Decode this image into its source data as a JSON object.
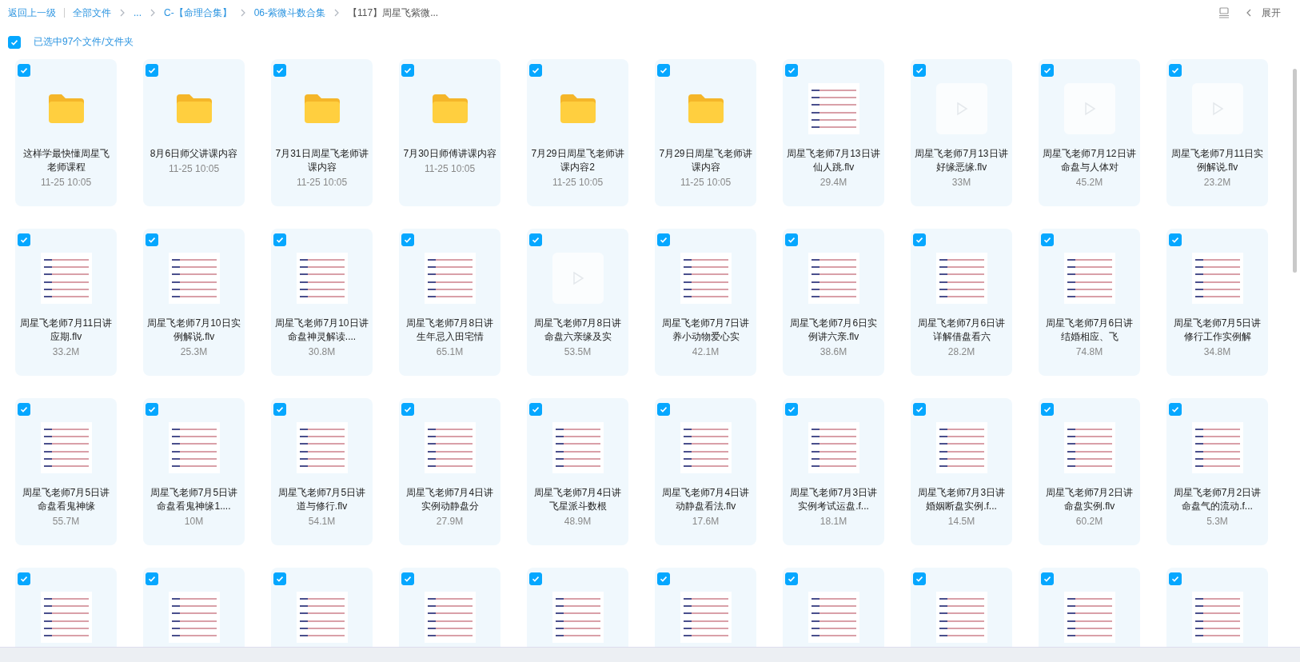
{
  "breadcrumb": {
    "back": "返回上一级",
    "items": [
      {
        "label": "全部文件",
        "current": false
      },
      {
        "label": "...",
        "current": false
      },
      {
        "label": "C-【命理合集】",
        "current": false
      },
      {
        "label": "06-紫微斗数合集",
        "current": false
      },
      {
        "label": "【117】周星飞紫微...",
        "current": true
      }
    ]
  },
  "toolbar": {
    "expand": "展开"
  },
  "selection": {
    "checked": true,
    "label": "已选中97个文件/文件夹"
  },
  "files": [
    {
      "kind": "folder",
      "checked": true,
      "name": "这样学最快懂周星飞老师课程",
      "meta": "11-25 10:05"
    },
    {
      "kind": "folder",
      "checked": true,
      "name": "8月6日师父讲课内容",
      "meta": "11-25 10:05"
    },
    {
      "kind": "folder",
      "checked": true,
      "name": "7月31日周星飞老师讲课内容",
      "meta": "11-25 10:05"
    },
    {
      "kind": "folder",
      "checked": true,
      "name": "7月30日师傅讲课内容",
      "meta": "11-25 10:05"
    },
    {
      "kind": "folder",
      "checked": true,
      "name": "7月29日周星飞老师讲课内容2",
      "meta": "11-25 10:05"
    },
    {
      "kind": "folder",
      "checked": true,
      "name": "7月29日周星飞老师讲课内容",
      "meta": "11-25 10:05"
    },
    {
      "kind": "video",
      "checked": true,
      "name": "周星飞老师7月13日讲仙人跳.flv",
      "meta": "29.4M"
    },
    {
      "kind": "blank",
      "checked": true,
      "name": "周星飞老师7月13日讲好缘恶缘.flv",
      "meta": "33M"
    },
    {
      "kind": "blank",
      "checked": true,
      "name": "周星飞老师7月12日讲命盘与人体对",
      "meta": "45.2M"
    },
    {
      "kind": "blank",
      "checked": true,
      "name": "周星飞老师7月11日实例解说.flv",
      "meta": "23.2M"
    },
    {
      "kind": "video",
      "checked": true,
      "name": "周星飞老师7月11日讲应期.flv",
      "meta": "33.2M"
    },
    {
      "kind": "video",
      "checked": true,
      "name": "周星飞老师7月10日实例解说.flv",
      "meta": "25.3M"
    },
    {
      "kind": "video",
      "checked": true,
      "name": "周星飞老师7月10日讲命盘神灵解读....",
      "meta": "30.8M"
    },
    {
      "kind": "video",
      "checked": true,
      "name": "周星飞老师7月8日讲生年忌入田宅情",
      "meta": "65.1M"
    },
    {
      "kind": "blank",
      "checked": true,
      "name": "周星飞老师7月8日讲命盘六亲缘及实",
      "meta": "53.5M"
    },
    {
      "kind": "video",
      "checked": true,
      "name": "周星飞老师7月7日讲养小动物爱心实",
      "meta": "42.1M"
    },
    {
      "kind": "video",
      "checked": true,
      "name": "周星飞老师7月6日实例讲六亲.flv",
      "meta": "38.6M"
    },
    {
      "kind": "video",
      "checked": true,
      "name": "周星飞老师7月6日讲详解借盘看六",
      "meta": "28.2M"
    },
    {
      "kind": "video",
      "checked": true,
      "name": "周星飞老师7月6日讲结婚相应、飞",
      "meta": "74.8M"
    },
    {
      "kind": "video",
      "checked": true,
      "name": "周星飞老师7月5日讲修行工作实例解",
      "meta": "34.8M"
    },
    {
      "kind": "video",
      "checked": true,
      "name": "周星飞老师7月5日讲命盘看鬼神缘",
      "meta": "55.7M"
    },
    {
      "kind": "video",
      "checked": true,
      "name": "周星飞老师7月5日讲命盘看鬼神缘1....",
      "meta": "10M"
    },
    {
      "kind": "video",
      "checked": true,
      "name": "周星飞老师7月5日讲道与修行.flv",
      "meta": "54.1M"
    },
    {
      "kind": "video",
      "checked": true,
      "name": "周星飞老师7月4日讲实例动静盘分",
      "meta": "27.9M"
    },
    {
      "kind": "video",
      "checked": true,
      "name": "周星飞老师7月4日讲飞星派斗数根",
      "meta": "48.9M"
    },
    {
      "kind": "video",
      "checked": true,
      "name": "周星飞老师7月4日讲动静盘看法.flv",
      "meta": "17.6M"
    },
    {
      "kind": "video",
      "checked": true,
      "name": "周星飞老师7月3日讲实例考试运盘.f...",
      "meta": "18.1M"
    },
    {
      "kind": "video",
      "checked": true,
      "name": "周星飞老师7月3日讲婚姻断盘实例.f...",
      "meta": "14.5M"
    },
    {
      "kind": "video",
      "checked": true,
      "name": "周星飞老师7月2日讲命盘实例.flv",
      "meta": "60.2M"
    },
    {
      "kind": "video",
      "checked": true,
      "name": "周星飞老师7月2日讲命盘气的流动.f...",
      "meta": "5.3M"
    },
    {
      "kind": "video",
      "checked": true
    },
    {
      "kind": "video",
      "checked": true
    },
    {
      "kind": "video",
      "checked": true
    },
    {
      "kind": "video",
      "checked": true
    },
    {
      "kind": "video",
      "checked": true
    },
    {
      "kind": "video",
      "checked": true
    },
    {
      "kind": "video",
      "checked": true
    },
    {
      "kind": "video",
      "checked": true
    },
    {
      "kind": "video",
      "checked": true
    },
    {
      "kind": "video",
      "checked": true
    }
  ]
}
